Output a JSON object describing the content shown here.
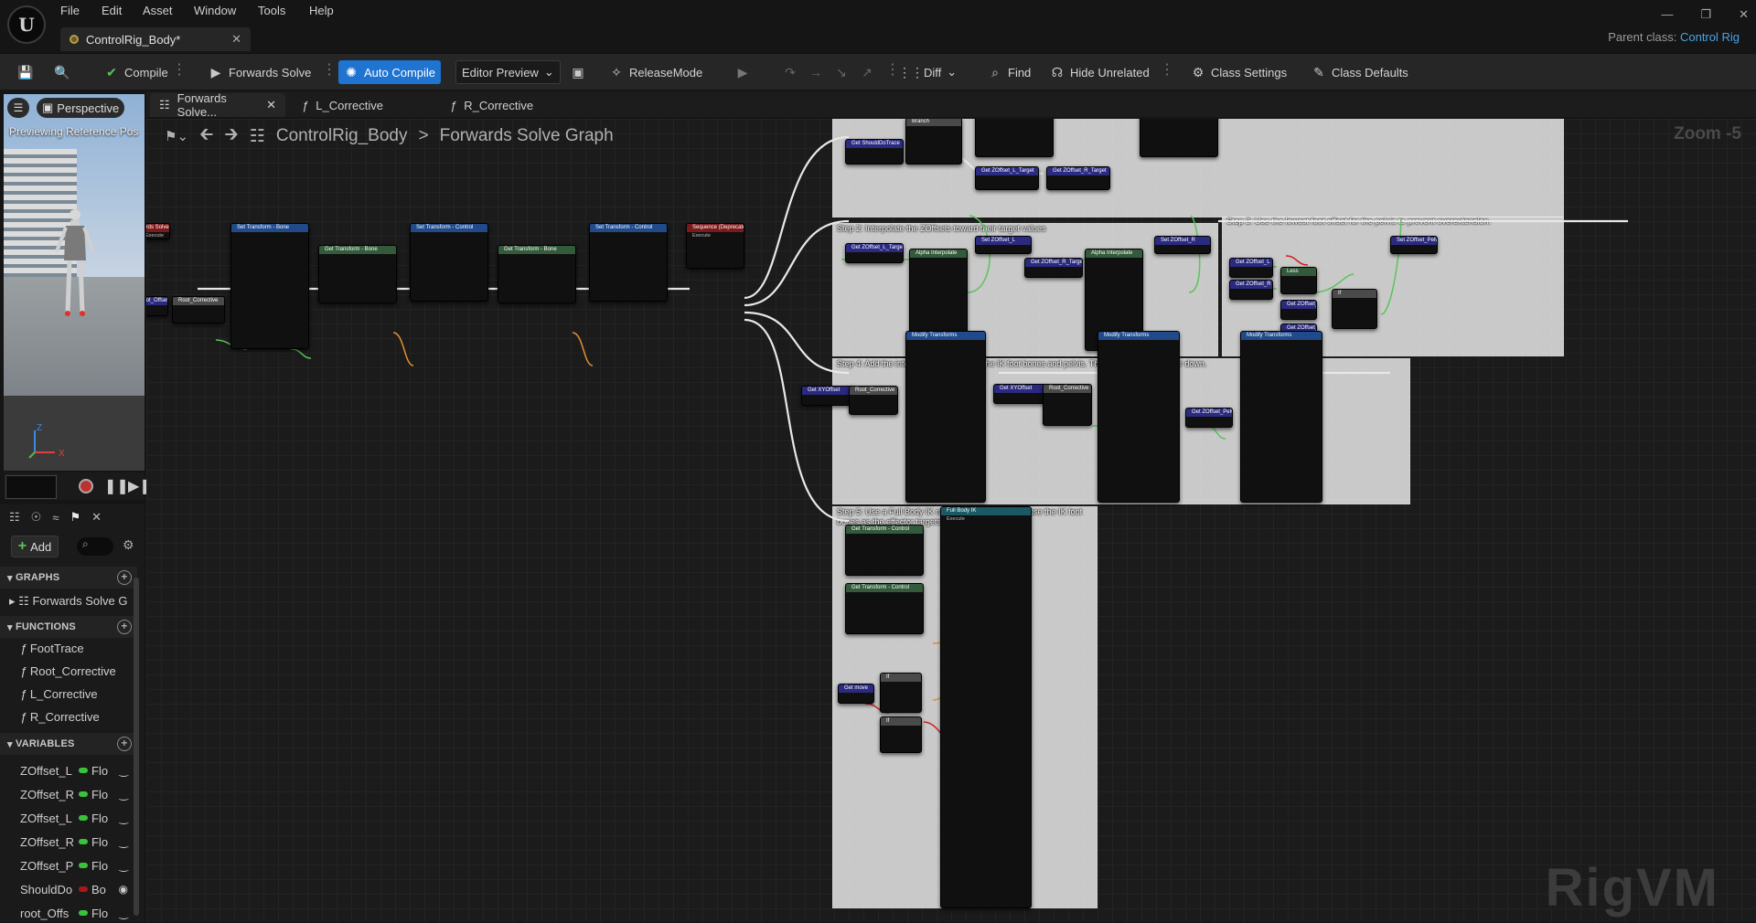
{
  "menu": {
    "logo": "U",
    "items": [
      "File",
      "Edit",
      "Asset",
      "Window",
      "Tools",
      "Help"
    ]
  },
  "document_tab": {
    "title": "ControlRig_Body*"
  },
  "parent_class": {
    "label": "Parent class:",
    "value": "Control Rig"
  },
  "toolbar": {
    "compile": "Compile",
    "forwards_solve": "Forwards Solve",
    "auto_compile": "Auto Compile",
    "editor_preview": "Editor Preview",
    "release_mode": "ReleaseMode",
    "diff": "Diff",
    "find": "Find",
    "hide_unrelated": "Hide Unrelated",
    "class_settings": "Class Settings",
    "class_defaults": "Class Defaults"
  },
  "viewport": {
    "perspective": "Perspective",
    "label": "Previewing Reference Pos"
  },
  "graph_tabs": [
    {
      "label": "Forwards Solve..."
    },
    {
      "label": "L_Corrective"
    },
    {
      "label": "R_Corrective"
    }
  ],
  "breadcrumb": {
    "root": "ControlRig_Body",
    "current": "Forwards Solve Graph"
  },
  "zoom": "Zoom -5",
  "watermark": "RigVM",
  "left_panel": {
    "add": "Add",
    "sections": {
      "graphs": "GRAPHS",
      "functions": "FUNCTIONS",
      "variables": "VARIABLES"
    },
    "graphs": [
      "Forwards Solve G"
    ],
    "functions": [
      "FootTrace",
      "Root_Corrective",
      "L_Corrective",
      "R_Corrective"
    ],
    "variables": [
      {
        "name": "ZOffset_L",
        "type": "Flo",
        "color": "#3ac23a"
      },
      {
        "name": "ZOffset_R",
        "type": "Flo",
        "color": "#3ac23a"
      },
      {
        "name": "ZOffset_L",
        "type": "Flo",
        "color": "#3ac23a"
      },
      {
        "name": "ZOffset_R",
        "type": "Flo",
        "color": "#3ac23a"
      },
      {
        "name": "ZOffset_P",
        "type": "Flo",
        "color": "#3ac23a"
      },
      {
        "name": "ShouldDo",
        "type": "Bo",
        "color": "#a81818"
      },
      {
        "name": "root_Offs",
        "type": "Flo",
        "color": "#3ac23a"
      }
    ]
  },
  "comments": {
    "step2": "Step 2: Interpolate the ZOffsets toward their target values",
    "step3": "Step 3: Use the lowest foot offset for the pelvis to prevent overextension.",
    "step4": "Step 4: Add the interpolated ZOffsets to the IK foot bones and pelvis. This will move them up or down.",
    "step5": "Step 5: Use a Full Body IK node to solve the IK, and use the IK foot bones as the effector targets for each foot."
  },
  "nodes": {
    "forwards_solve": "Forwards Solve",
    "execute": "Execute",
    "set_transform_bone": "Set Transform - Bone",
    "set_transform_control": "Set Transform - Control",
    "get_transform_bone": "Get Transform - Bone",
    "get_transform_control": "Get Transform - Control",
    "sequence": "Sequence (Deprecated)",
    "alpha_interpolate": "Alpha Interpolate",
    "modify_transforms": "Modify Transforms",
    "full_body_ik": "Full Body IK",
    "get_root_offset": "Get root_Offset",
    "root_corrective": "Root_Corrective",
    "branch": "Branch",
    "less": "Less",
    "if": "If",
    "get_should_do_trace": "Get ShouldDoTrace",
    "get_zoffset_l_target": "Get ZOffset_L_Target",
    "get_zoffset_r_target": "Get ZOffset_R_Target",
    "set_zoffset_l": "Set ZOffset_L",
    "set_zoffset_r": "Set ZOffset_R",
    "set_zoffset_pelvis": "Set ZOffset_Pelvis",
    "get_zoffset_l": "Get ZOffset_L",
    "get_zoffset_r": "Get ZOffset_R",
    "get_zoffset_pelvis": "Get ZOffset_Pelvis",
    "get_xyoffset": "Get XYOffset",
    "get_move": "Get move"
  }
}
